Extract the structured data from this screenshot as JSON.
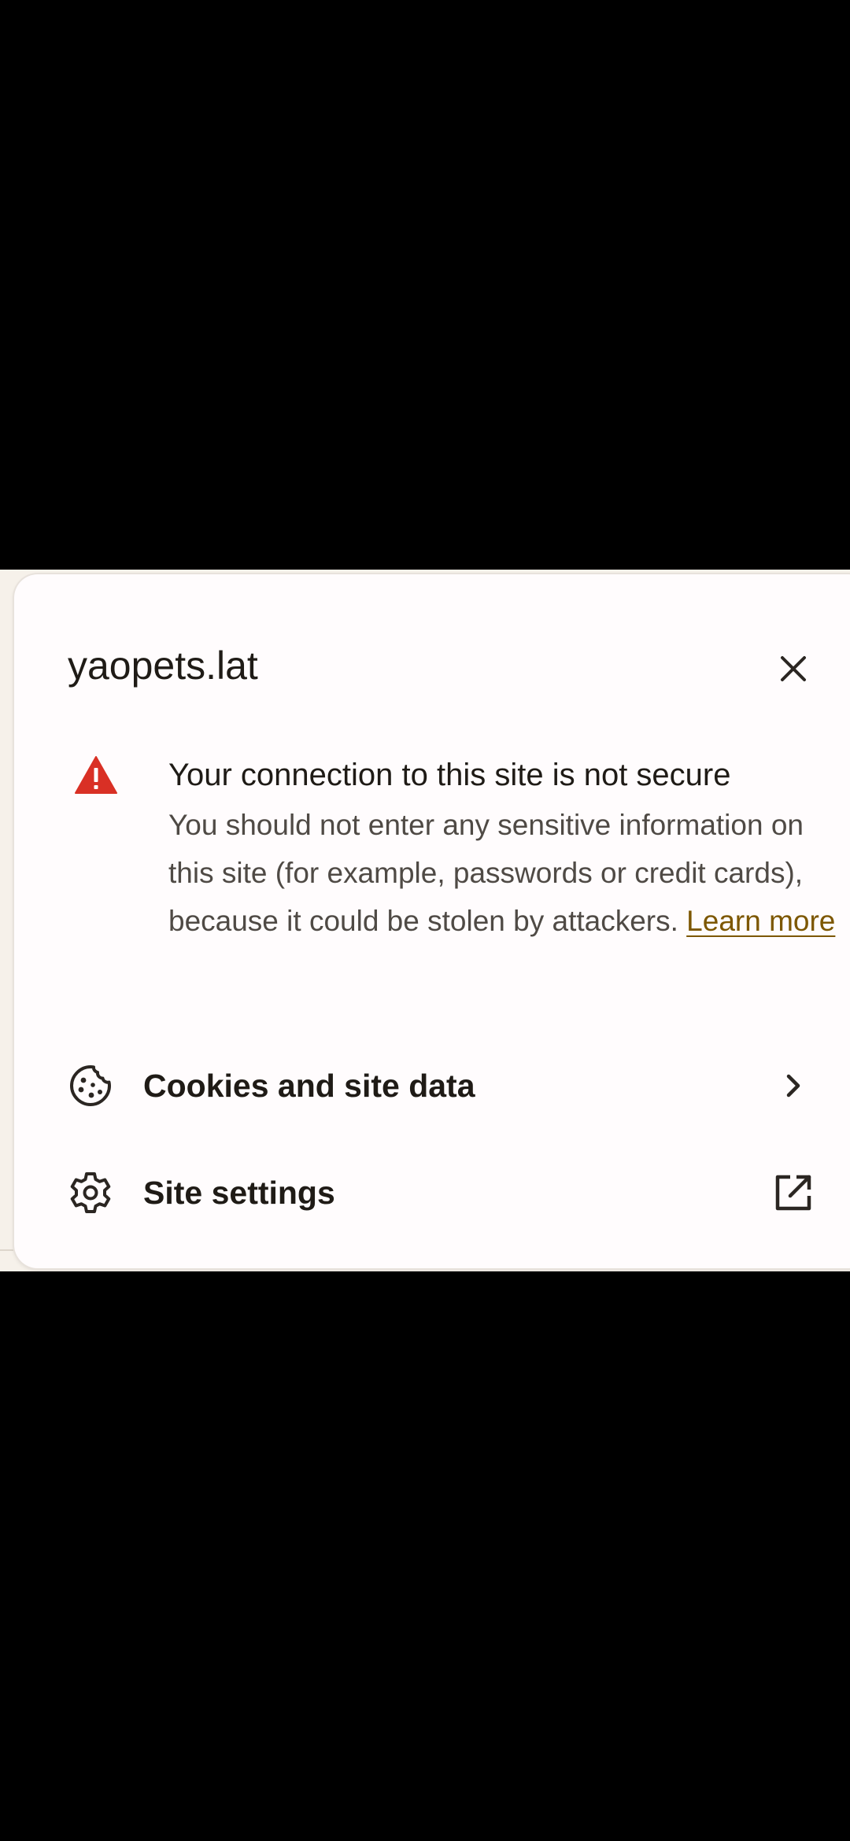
{
  "dialog": {
    "site_name": "yaopets.lat",
    "warning": {
      "title": "Your connection to this site is not secure",
      "body": "You should not enter any sensitive information on this site (for example, passwords or credit cards), because it could be stolen by attackers. ",
      "link": "Learn more",
      "icon": "warning-triangle-icon",
      "icon_color": "#d93025"
    },
    "rows": [
      {
        "label": "Cookies and site data",
        "icon": "cookie-icon",
        "trailing_icon": "chevron-right-icon"
      },
      {
        "label": "Site settings",
        "icon": "gear-icon",
        "trailing_icon": "open-external-icon"
      }
    ]
  },
  "colors": {
    "sheet_background": "#fffcfd",
    "text_primary": "#1f1b16",
    "text_secondary": "#4f4a45",
    "link": "#7d5700"
  }
}
